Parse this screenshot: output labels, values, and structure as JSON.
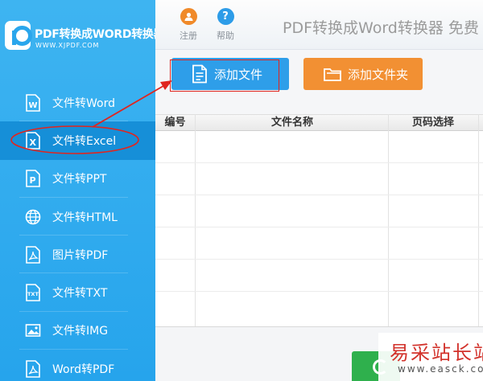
{
  "app": {
    "logo_title": "PDF转换成WORD转换器",
    "logo_url": "WWW.XJPDF.COM",
    "title": "PDF转换成Word转换器 免费"
  },
  "toolbar": {
    "register_label": "注册",
    "help_label": "帮助"
  },
  "sidebar": {
    "items": [
      {
        "label": "文件转Word",
        "icon": "word-file-icon"
      },
      {
        "label": "文件转Excel",
        "icon": "excel-file-icon",
        "active": true
      },
      {
        "label": "文件转PPT",
        "icon": "ppt-file-icon"
      },
      {
        "label": "文件转HTML",
        "icon": "globe-icon"
      },
      {
        "label": "图片转PDF",
        "icon": "pdf-file-icon"
      },
      {
        "label": "文件转TXT",
        "icon": "txt-file-icon"
      },
      {
        "label": "文件转IMG",
        "icon": "image-icon"
      },
      {
        "label": "Word转PDF",
        "icon": "pdf-file-icon"
      }
    ]
  },
  "actions": {
    "add_file_label": "添加文件",
    "add_folder_label": "添加文件夹"
  },
  "table": {
    "columns": [
      "编号",
      "文件名称",
      "页码选择"
    ],
    "rows": []
  },
  "watermark": {
    "title": "易采站长站",
    "url": "www.easck.com"
  },
  "colors": {
    "sidebar": "#2aa6ec",
    "sidebar_active": "#168fd8",
    "add_file_button": "#2e9ee9",
    "add_folder_button": "#f29033",
    "annotation_red": "#e0251f",
    "start_button": "#2fb04d"
  }
}
